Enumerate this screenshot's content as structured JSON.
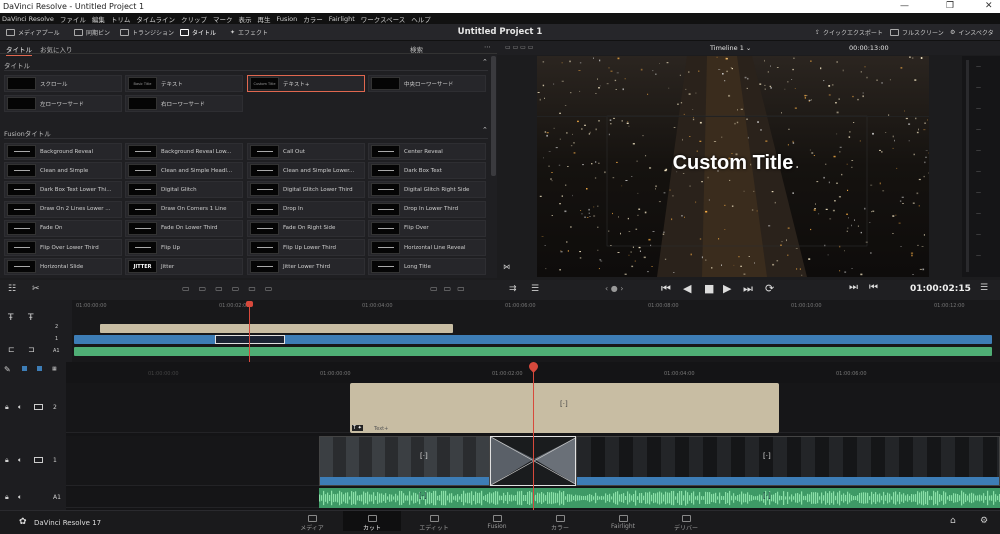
{
  "window": {
    "title": "DaVinci Resolve - Untitled Project 1"
  },
  "menu": [
    "DaVinci Resolve",
    "ファイル",
    "編集",
    "トリム",
    "タイムライン",
    "クリップ",
    "マーク",
    "表示",
    "再生",
    "Fusion",
    "カラー",
    "Fairlight",
    "ワークスペース",
    "ヘルプ"
  ],
  "toolbar": {
    "media_pool": "メディアプール",
    "sync_bin": "同期ビン",
    "transitions": "トランジション",
    "titles": "タイトル",
    "effects": "エフェクト",
    "project_title": "Untitled Project 1",
    "quick_export": "クイックエクスポート",
    "fullscreen": "フルスクリーン",
    "inspector": "インスペクタ"
  },
  "browser": {
    "tab_titles": "タイトル",
    "tab_favorites": "お気に入り",
    "search": "検索",
    "section_titles": "タイトル",
    "section_fusion": "Fusionタイトル",
    "titles": [
      {
        "label": "スクロール",
        "thumb": ""
      },
      {
        "label": "テキスト",
        "thumb": "Basic Title"
      },
      {
        "label": "テキスト+",
        "thumb": "Custom Title"
      },
      {
        "label": "中央ローワーサード",
        "thumb": ""
      },
      {
        "label": "左ローワーサード",
        "thumb": ""
      },
      {
        "label": "右ローワーサード",
        "thumb": ""
      }
    ],
    "fusion_titles": [
      "Background Reveal",
      "Background Reveal Low...",
      "Call Out",
      "Center Reveal",
      "Clean and Simple",
      "Clean and Simple Headl...",
      "Clean and Simple Lower...",
      "Dark Box Text",
      "Dark Box Text Lower Thi...",
      "Digital Glitch",
      "Digital Glitch Lower Third",
      "Digital Glitch Right Side",
      "Draw On 2 Lines Lower ...",
      "Draw On Corners 1 Line",
      "Drop In",
      "Drop In Lower Third",
      "Fade On",
      "Fade On Lower Third",
      "Fade On Right Side",
      "Flip Over",
      "Flip Over Lower Third",
      "Flip Up",
      "Flip Up Lower Third",
      "Horizontal Line Reveal",
      "Horizontal Slide",
      "Jitter",
      "Jitter Lower Third",
      "Long Title"
    ],
    "jitter_thumb": "JITTER"
  },
  "viewer": {
    "timeline_name": "Timeline 1",
    "timecode_top": "00:00:13:00",
    "overlay_title": "Custom Title",
    "timecode": "01:00:02:15"
  },
  "upper_timeline": {
    "ruler": [
      "01:00:00:00",
      "01:00:02:00",
      "01:00:04:00",
      "01:00:06:00",
      "01:00:08:00",
      "01:00:10:00",
      "01:00:12:00"
    ],
    "track_v2": "2",
    "track_v1": "1",
    "track_a1": "A1"
  },
  "lower_timeline": {
    "ruler": [
      "01:00:00:00",
      "01:00:02:00",
      "01:00:04:00",
      "01:00:06:00"
    ],
    "ruler_faint": "01:00:00:00",
    "tracks": [
      {
        "label": "2"
      },
      {
        "label": "1"
      },
      {
        "label": "A1"
      }
    ],
    "clip_label": "Text+"
  },
  "pages": [
    "メディア",
    "カット",
    "エディット",
    "Fusion",
    "カラー",
    "Fairlight",
    "デリバー"
  ],
  "active_page": "カット",
  "app_name": "DaVinci Resolve 17",
  "colors": {
    "accent": "#e0674f",
    "playhead": "#d7493c",
    "title_clip": "#c8bda3",
    "audio": "#4fae75",
    "video_bar": "#3d7db6"
  }
}
